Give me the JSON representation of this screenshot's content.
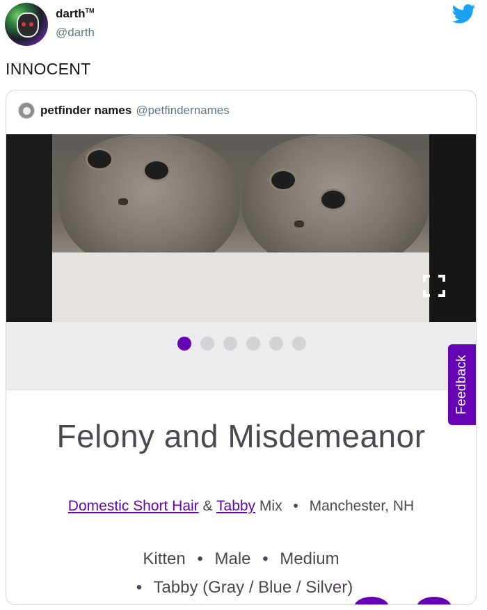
{
  "tweet": {
    "display_name": "darth",
    "display_name_suffix": "TM",
    "handle": "@darth",
    "text": "INNOCENT",
    "logo_icon": "twitter-bird-icon",
    "logo_color": "#1da1f2"
  },
  "quoted_tweet": {
    "display_name": "petfinder names",
    "handle": "@petfindernames",
    "listing": {
      "photo_count": 6,
      "active_photo_index": 0,
      "expand_icon": "fullscreen-icon",
      "feedback_label": "Feedback",
      "pet_name": "Felony and Misdemeanor",
      "breed_primary": "Domestic Short Hair",
      "breed_joiner": "&",
      "breed_secondary": "Tabby",
      "breed_suffix": "Mix",
      "bullet": "•",
      "location": "Manchester, NH",
      "age": "Kitten",
      "sex": "Male",
      "size": "Medium",
      "color": "Tabby (Gray / Blue / Silver)",
      "accent_color": "#6504b5"
    }
  }
}
